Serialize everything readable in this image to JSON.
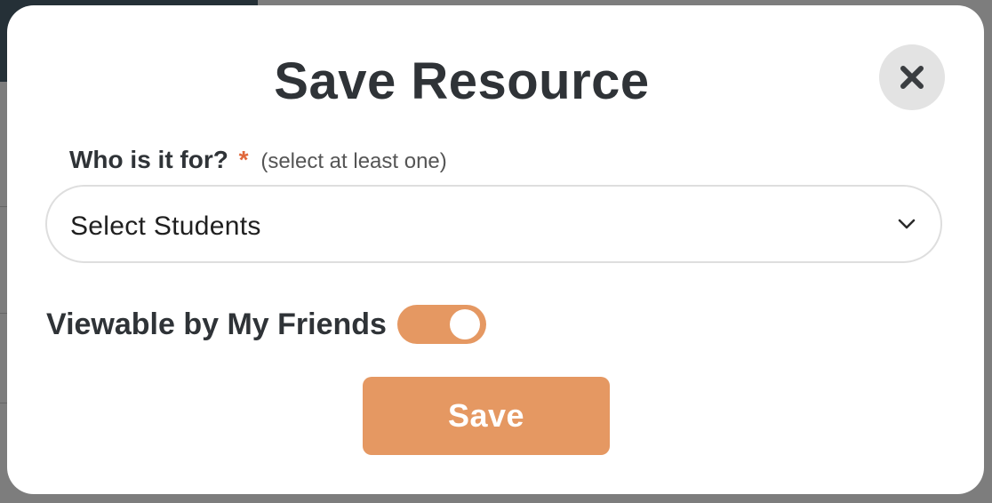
{
  "modal": {
    "title": "Save Resource",
    "close_icon": "close-icon"
  },
  "audience_field": {
    "label": "Who is it for?",
    "required_marker": "*",
    "hint": "(select at least one)",
    "select_value": "Select Students",
    "chevron_icon": "chevron-down-icon"
  },
  "visibility": {
    "label": "Viewable by My Friends",
    "toggle_on": true
  },
  "actions": {
    "save_label": "Save"
  },
  "colors": {
    "accent": "#e59862",
    "required": "#e0673a",
    "title_text": "#2f3337",
    "close_bg": "#e3e3e3"
  }
}
